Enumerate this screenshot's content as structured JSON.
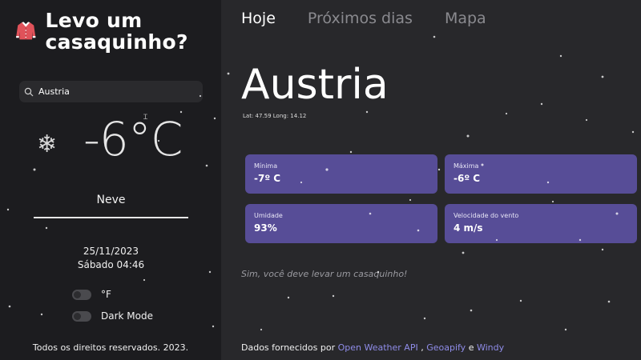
{
  "app": {
    "title": "Levo um casaquinho?"
  },
  "search": {
    "value": "Austria",
    "placeholder": ""
  },
  "current": {
    "condition_icon": "snowflake-icon",
    "temperature": "-6°C",
    "condition": "Neve",
    "date": "25/11/2023",
    "weekday_time": "Sábado 04:46"
  },
  "toggles": {
    "fahrenheit_label": "°F",
    "dark_mode_label": "Dark Mode"
  },
  "footer_left": "Todos os direitos reservados. 2023.",
  "tabs": [
    {
      "label": "Hoje",
      "active": true
    },
    {
      "label": "Próximos dias",
      "active": false
    },
    {
      "label": "Mapa",
      "active": false
    }
  ],
  "location": {
    "name": "Austria",
    "coords": "Lat: 47.59 Long: 14.12"
  },
  "cards": {
    "min": {
      "label": "Mínima",
      "value": "-7º C"
    },
    "max": {
      "label": "Máxima",
      "value": "-6º C"
    },
    "humidity": {
      "label": "Umidade",
      "value": "93%"
    },
    "wind": {
      "label": "Velocidade do vento",
      "value": "4 m/s"
    }
  },
  "advice": "Sim, você deve levar um casaquinho!",
  "footer_right": {
    "prefix": "Dados fornecidos por ",
    "link1": "Open Weather API",
    "sep1": " , ",
    "link2": "Geoapify",
    "sep2": " e ",
    "link3": "Windy"
  },
  "colors": {
    "accent": "#574d97",
    "link": "#8f8ce8",
    "sidebar_bg": "#1c1c1f",
    "main_bg": "#28282b",
    "brand_icon": "#e0525a"
  }
}
